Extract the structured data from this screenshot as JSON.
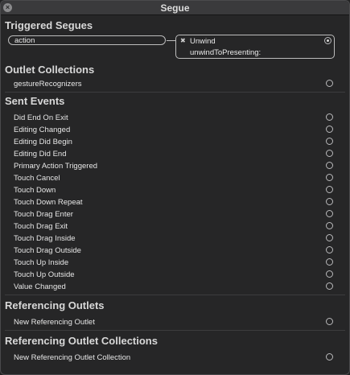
{
  "window": {
    "title": "Segue",
    "close_glyph": "×"
  },
  "triggered_segues": {
    "header": "Triggered Segues",
    "action_label": "action",
    "unwind_title": "Unwind",
    "unwind_selector": "unwindToPresenting:"
  },
  "outlet_collections": {
    "header": "Outlet Collections",
    "items": [
      "gestureRecognizers"
    ]
  },
  "sent_events": {
    "header": "Sent Events",
    "items": [
      "Did End On Exit",
      "Editing Changed",
      "Editing Did Begin",
      "Editing Did End",
      "Primary Action Triggered",
      "Touch Cancel",
      "Touch Down",
      "Touch Down Repeat",
      "Touch Drag Enter",
      "Touch Drag Exit",
      "Touch Drag Inside",
      "Touch Drag Outside",
      "Touch Up Inside",
      "Touch Up Outside",
      "Value Changed"
    ]
  },
  "referencing_outlets": {
    "header": "Referencing Outlets",
    "items": [
      "New Referencing Outlet"
    ]
  },
  "referencing_outlet_collections": {
    "header": "Referencing Outlet Collections",
    "items": [
      "New Referencing Outlet Collection"
    ]
  }
}
